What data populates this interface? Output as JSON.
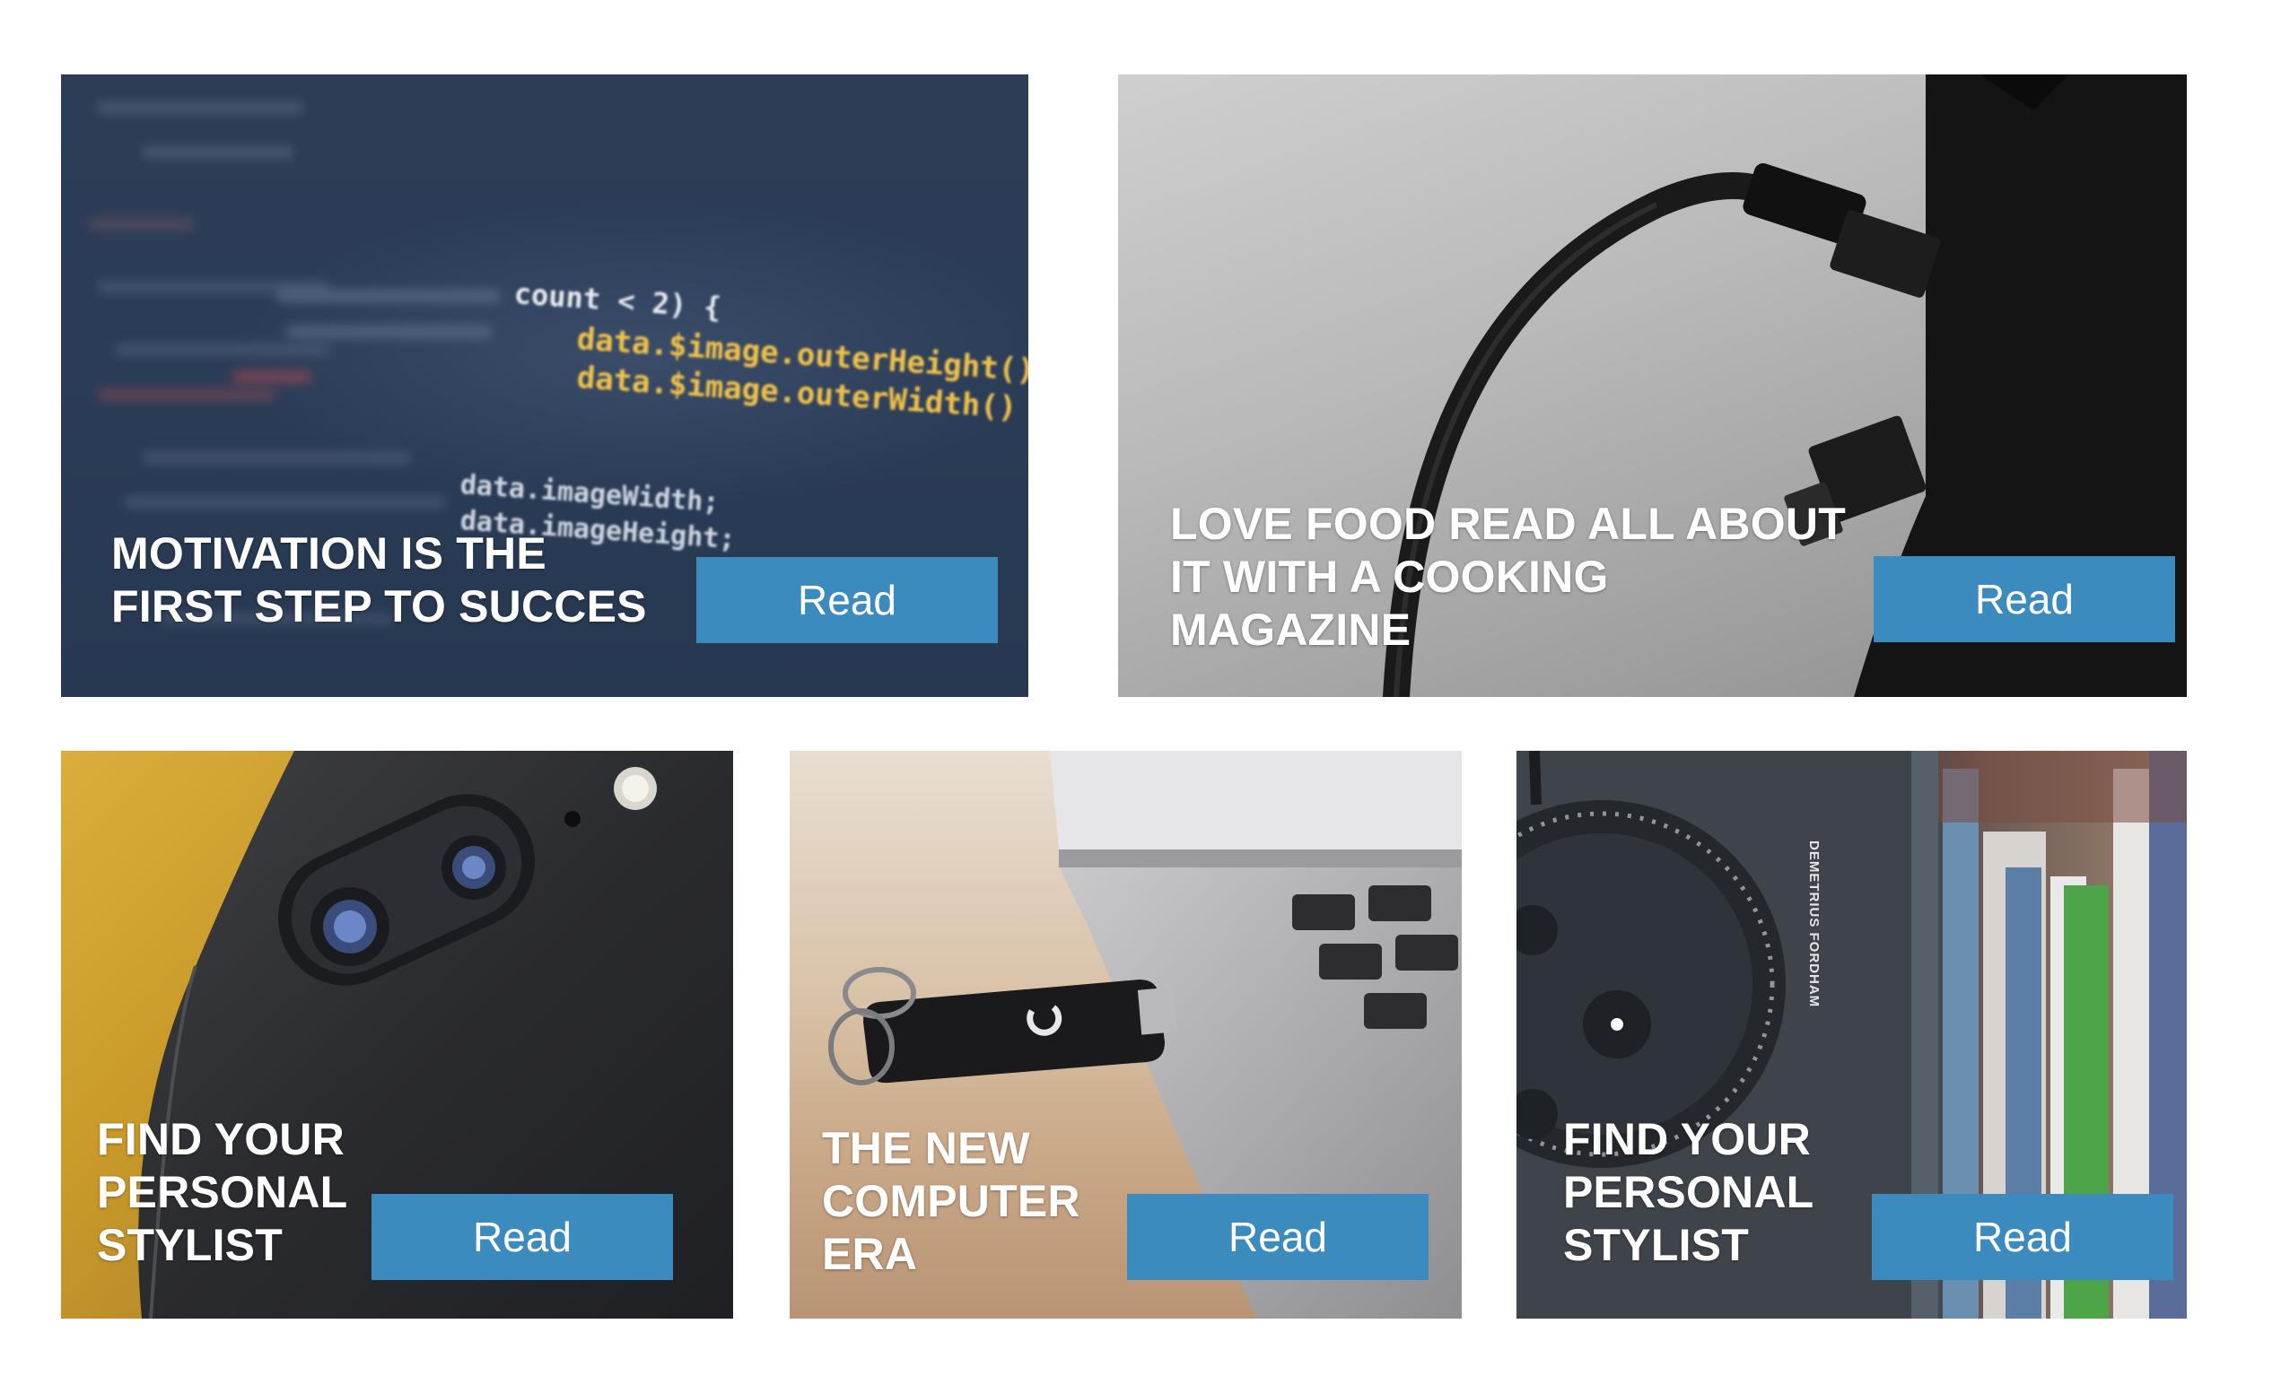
{
  "cards": [
    {
      "title": "MOTIVATION IS THE\nFIRST STEP TO SUCCES",
      "button_label": "Read",
      "code_lines": [
        "count < 2) {",
        "data.$image.outerHeight()",
        "data.$image.outerWidth()",
        "data.imageWidth;",
        "data.imageHeight;"
      ]
    },
    {
      "title": "LOVE FOOD READ ALL ABOUT\nIT WITH A COOKING\nMAGAZINE",
      "button_label": "Read"
    },
    {
      "title": "FIND YOUR\nPERSONAL\nSTYLIST",
      "button_label": "Read"
    },
    {
      "title": "THE NEW\nCOMPUTER\nERA",
      "button_label": "Read"
    },
    {
      "title": "FIND YOUR\nPERSONAL\nSTYLIST",
      "button_label": "Read",
      "book_spine_text": "DEMETRIUS FORDHAM"
    }
  ],
  "colors": {
    "button": "#3c8bbf",
    "title_text": "#ffffff",
    "page_background": "#ffffff"
  }
}
